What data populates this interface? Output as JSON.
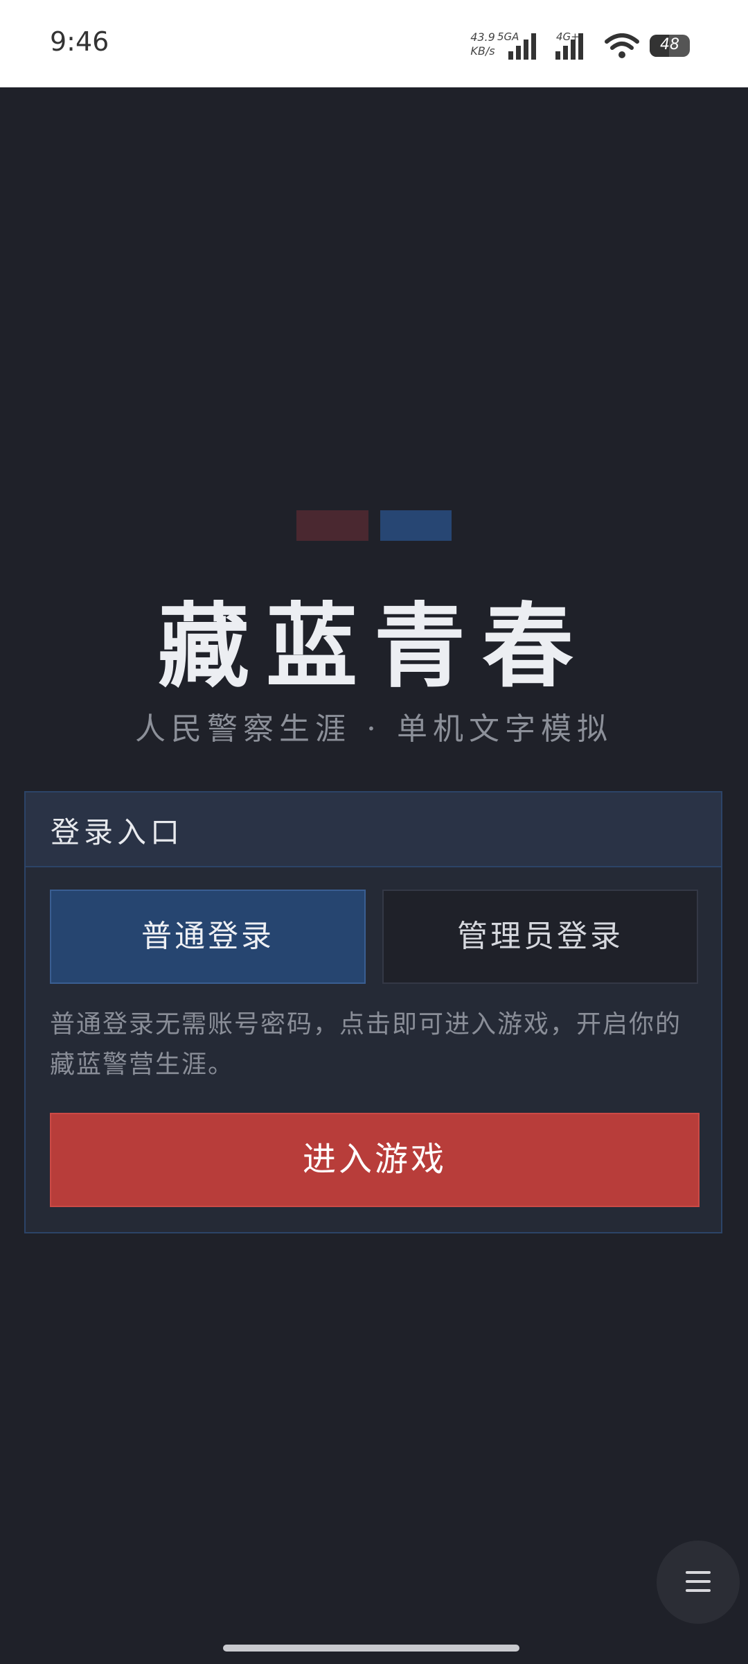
{
  "status_bar": {
    "time": "9:46",
    "net_speed_value": "43.9",
    "net_speed_unit": "KB/s",
    "net_type_1": "5GA",
    "net_type_2": "4G+",
    "battery_percent": "48",
    "battery_level": 0.48
  },
  "app": {
    "title": "藏蓝青春",
    "subtitle": "人民警察生涯 · 单机文字模拟",
    "flag_colors": [
      "#4a2830",
      "#274673"
    ]
  },
  "login_panel": {
    "header": "登录入口",
    "tabs": [
      {
        "label": "普通登录",
        "active": true
      },
      {
        "label": "管理员登录",
        "active": false
      }
    ],
    "description": "普通登录无需账号密码，点击即可进入游戏，开启你的藏蓝警营生涯。",
    "enter_button_label": "进入游戏",
    "accent_color": "#b83d3a"
  },
  "floating_menu": {
    "icon": "hamburger-menu-icon"
  }
}
